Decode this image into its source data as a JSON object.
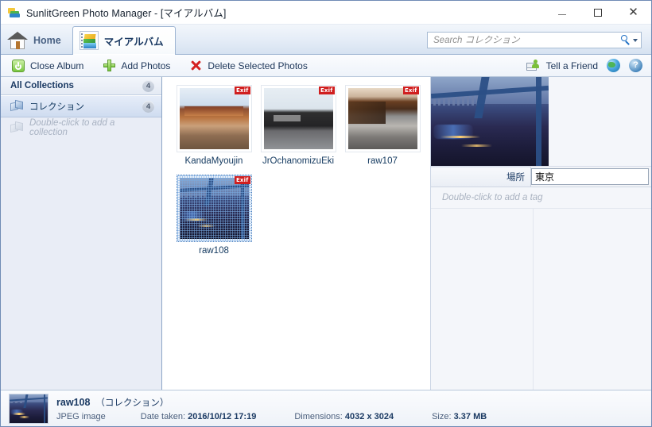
{
  "window": {
    "title": "SunlitGreen Photo Manager - [マイアルバム]",
    "app_icon": "photo-album-icon",
    "minimize_label": "",
    "maximize_label": "",
    "close_label": "✕"
  },
  "tabs": [
    {
      "label": "Home",
      "icon": "home-icon",
      "active": false
    },
    {
      "label": "マイアルバム",
      "icon": "album-icon",
      "active": true
    }
  ],
  "search": {
    "placeholder": "Search コレクション",
    "value": "",
    "icon": "search-icon",
    "dropdown_icon": "chevron-down-icon"
  },
  "toolbar": {
    "close_album": "Close Album",
    "add_photos": "Add Photos",
    "delete_selected": "Delete Selected Photos",
    "tell_a_friend": "Tell a Friend",
    "globe_icon": "globe-icon",
    "help_icon": "help-icon"
  },
  "sidebar": {
    "header": {
      "label": "All Collections",
      "count": "4"
    },
    "items": [
      {
        "label": "コレクション",
        "count": "4",
        "selected": true,
        "icon": "collection-icon"
      }
    ],
    "add_hint": "Double-click to add a collection"
  },
  "gallery": {
    "items": [
      {
        "label": "KandaMyoujin",
        "badge": "Exif",
        "selected": false
      },
      {
        "label": "JrOchanomizuEki",
        "badge": "Exif",
        "selected": false
      },
      {
        "label": "raw107",
        "badge": "Exif",
        "selected": false
      },
      {
        "label": "raw108",
        "badge": "Exif",
        "selected": true
      }
    ]
  },
  "details": {
    "preview_alt": "bridge-at-dusk-preview",
    "tags": [
      {
        "name": "場所",
        "value": "東京"
      }
    ],
    "add_tag_hint": "Double-click to add a tag"
  },
  "status": {
    "name": "raw108",
    "collection": "（コレクション）",
    "type": "JPEG image",
    "date_label": "Date taken:",
    "date_value": "2016/10/12 17:19",
    "dimensions_label": "Dimensions:",
    "dimensions_value": "4032 x 3024",
    "size_label": "Size:",
    "size_value": "3.37 MB"
  },
  "colors": {
    "accent": "#1b3a63",
    "exif_badge": "#d01f1f",
    "chrome_border": "#6f8bb5",
    "sidebar_bg": "#e9edf6"
  }
}
